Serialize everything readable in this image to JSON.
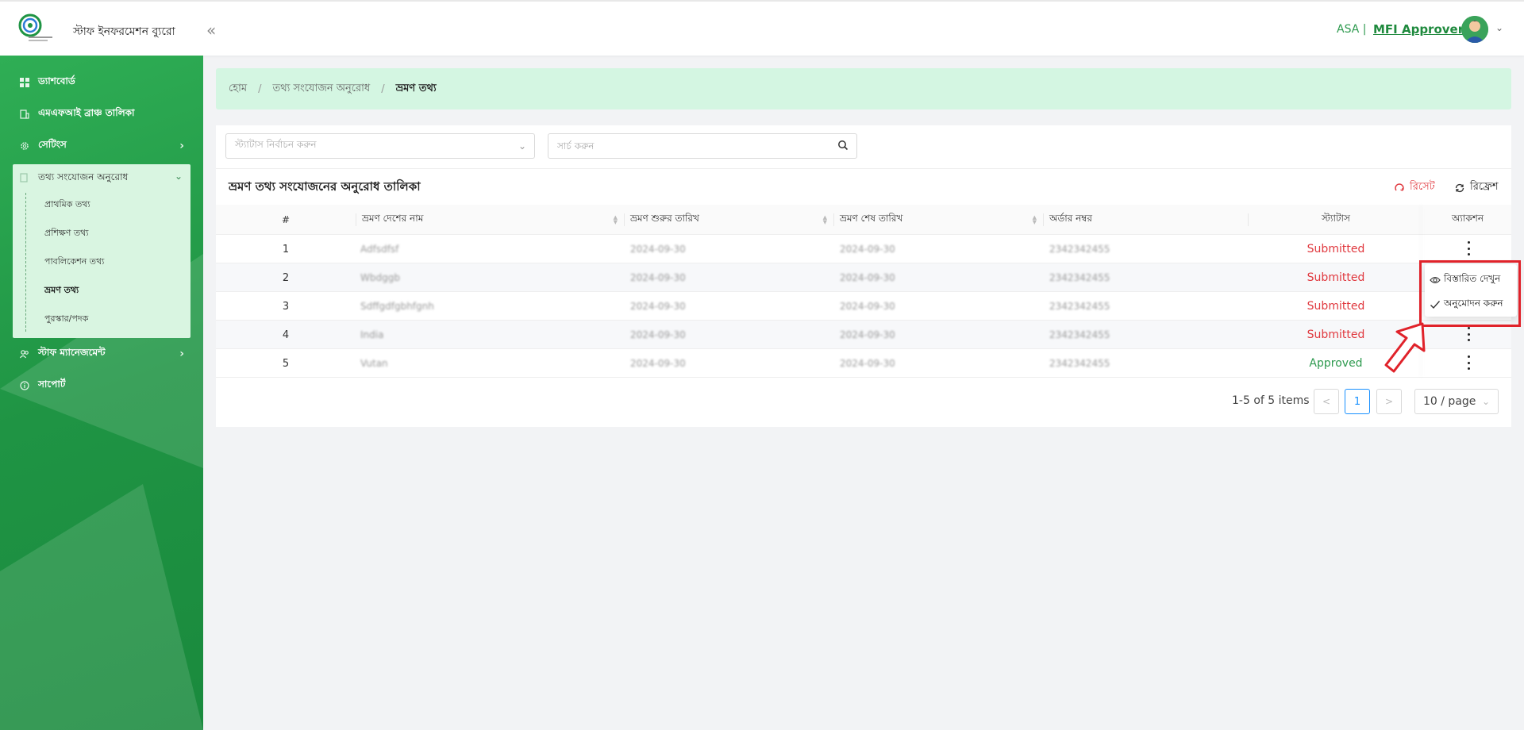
{
  "header": {
    "brand_title": "স্টাফ ইনফরমেশন ব্যুরো",
    "collapse_glyph": "«",
    "org": "ASA |",
    "role": "MFI Approver",
    "chevron": "⌄"
  },
  "sidebar": {
    "items": [
      {
        "label": "ড্যাশবোর্ড",
        "icon": "dashboard-icon"
      },
      {
        "label": "এমএফআই ব্রাঞ্চ তালিকা",
        "icon": "building-icon"
      },
      {
        "label": "সেটিংস",
        "icon": "gear-icon"
      },
      {
        "label": "স্টাফ ম্যানেজমেন্ট",
        "icon": "users-icon"
      },
      {
        "label": "সাপোর্ট",
        "icon": "info-icon"
      }
    ],
    "submenu": {
      "label": "তথ্য সংযোজন অনুরোধ",
      "icon": "document-icon",
      "children": [
        "প্রাথমিক তথ্য",
        "প্রশিক্ষণ তথ্য",
        "পাবলিকেশন তথ্য",
        "ভ্রমণ তথ্য",
        "পুরস্কার/পদক"
      ],
      "active": "ভ্রমণ তথ্য"
    }
  },
  "breadcrumb": {
    "items": [
      "হোম",
      "তথ্য সংযোজন অনুরোধ",
      "ভ্রমণ তথ্য"
    ],
    "separator": "/"
  },
  "filters": {
    "status_placeholder": "স্ট্যাটাস নির্বাচন করুন",
    "search_placeholder": "সার্চ করুন"
  },
  "card": {
    "title": "ভ্রমণ তথ্য সংযোজনের অনুরোধ তালিকা",
    "reset_label": "রিসেট",
    "refresh_label": "রিফ্রেশ"
  },
  "table": {
    "columns": [
      "#",
      "ভ্রমণ দেশের নাম",
      "ভ্রমণ শুরুর তারিখ",
      "ভ্রমণ শেষ তারিখ",
      "অর্ডার নম্বর",
      "স্ট্যাটাস",
      "অ্যাকশন"
    ],
    "rows": [
      {
        "no": "1",
        "country": "Adfsdfsf",
        "start": "2024-09-30",
        "end": "2024-09-30",
        "order": "2342342455",
        "status": "Submitted"
      },
      {
        "no": "2",
        "country": "Wbdggb",
        "start": "2024-09-30",
        "end": "2024-09-30",
        "order": "2342342455",
        "status": "Submitted"
      },
      {
        "no": "3",
        "country": "Sdffgdfgbhfgnh",
        "start": "2024-09-30",
        "end": "2024-09-30",
        "order": "2342342455",
        "status": "Submitted"
      },
      {
        "no": "4",
        "country": "India",
        "start": "2024-09-30",
        "end": "2024-09-30",
        "order": "2342342455",
        "status": "Submitted"
      },
      {
        "no": "5",
        "country": "Vutan",
        "start": "2024-09-30",
        "end": "2024-09-30",
        "order": "2342342455",
        "status": "Approved"
      }
    ]
  },
  "pagination": {
    "info": "1-5 of 5 items",
    "prev": "<",
    "current": "1",
    "next": ">",
    "page_size": "10 / page"
  },
  "action_menu": {
    "view_label": "বিস্তারিত দেখুন",
    "approve_label": "অনুমোদন করুন"
  },
  "colors": {
    "brand_green": "#1f9444",
    "submitted": "#e0383e",
    "approved": "#2e9a4f",
    "highlight": "#e0222a"
  }
}
